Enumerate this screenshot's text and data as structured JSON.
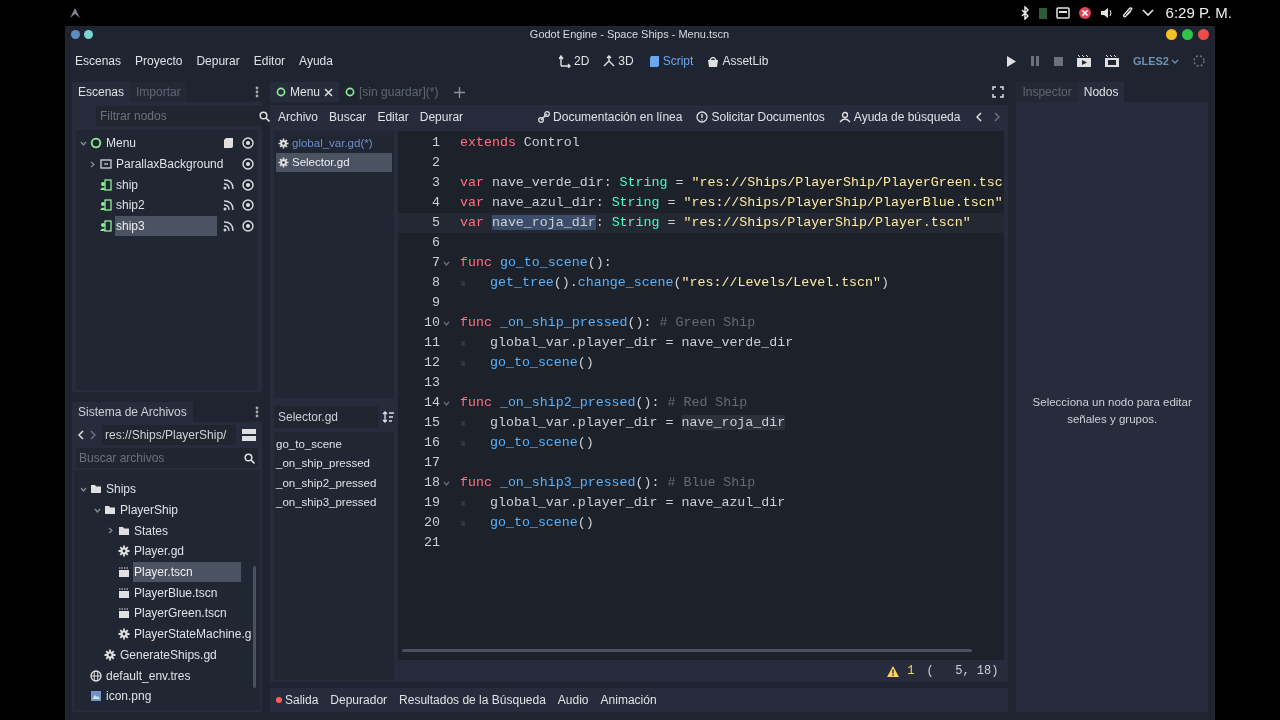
{
  "system_bar": {
    "time": "6:29 P. M."
  },
  "window": {
    "title": "Godot Engine - Space Ships - Menu.tscn"
  },
  "menu_bar": [
    "Escenas",
    "Proyecto",
    "Depurar",
    "Editor",
    "Ayuda"
  ],
  "workspaces": [
    {
      "kind": "flat",
      "label": "2D",
      "selected": false
    },
    {
      "kind": "spatial",
      "label": "3D",
      "selected": false
    },
    {
      "kind": "script",
      "label": "Script",
      "selected": true
    },
    {
      "kind": "assetlib",
      "label": "AssetLib",
      "selected": false
    }
  ],
  "renderer": "GLES2",
  "scene_dock": {
    "tabs": [
      {
        "label": "Escenas",
        "selected": true
      },
      {
        "label": "Importar",
        "selected": false
      }
    ],
    "filter": {
      "placeholder": "Filtrar nodos"
    },
    "tree": [
      {
        "label": "Menu",
        "kind": "control",
        "expanded": true,
        "selected": false,
        "children": [
          {
            "label": "ParallaxBackground",
            "kind": "parallax",
            "expanded": false,
            "selected": false
          },
          {
            "label": "ship",
            "kind": "instance",
            "selected": false
          },
          {
            "label": "ship2",
            "kind": "instance",
            "selected": false
          },
          {
            "label": "ship3",
            "kind": "instance",
            "selected": true
          }
        ]
      }
    ]
  },
  "filesystem": {
    "tab": "Sistema de Archivos",
    "path": "res://Ships/PlayerShip/",
    "search": {
      "placeholder": "Buscar archivos"
    },
    "tree": [
      {
        "label": "Ships",
        "kind": "folder",
        "expanded": true,
        "selected": false,
        "children": [
          {
            "label": "PlayerShip",
            "kind": "folder",
            "expanded": true,
            "selected": false,
            "children": [
              {
                "label": "States",
                "kind": "folder",
                "expanded": false,
                "selected": false
              },
              {
                "label": "Player.gd",
                "kind": "script",
                "selected": false
              },
              {
                "label": "Player.tscn",
                "kind": "scene",
                "selected": true
              },
              {
                "label": "PlayerBlue.tscn",
                "kind": "scene",
                "selected": false
              },
              {
                "label": "PlayerGreen.tscn",
                "kind": "scene",
                "selected": false
              },
              {
                "label": "PlayerStateMachine.g",
                "kind": "script",
                "selected": false
              }
            ]
          },
          {
            "label": "GenerateShips.gd",
            "kind": "script",
            "selected": false
          }
        ]
      },
      {
        "label": "default_env.tres",
        "kind": "environment",
        "selected": false
      },
      {
        "label": "icon.png",
        "kind": "image",
        "selected": false
      }
    ]
  },
  "scene_tabs": [
    {
      "label": "Menu",
      "selected": true
    },
    {
      "label": "[sin guardar](*)",
      "selected": false
    }
  ],
  "script_menu": [
    "Archivo",
    "Buscar",
    "Editar",
    "Depurar"
  ],
  "help_links": [
    {
      "kind": "docs",
      "label": "Documentación en línea"
    },
    {
      "kind": "request",
      "label": "Solicitar Documentos"
    },
    {
      "kind": "search",
      "label": "Ayuda de búsqueda"
    }
  ],
  "scripts": [
    {
      "label": "global_var.gd(*)",
      "modified": true,
      "selected": false
    },
    {
      "label": "Selector.gd",
      "modified": false,
      "selected": true
    }
  ],
  "methods": {
    "filter": "Selector.gd",
    "items": [
      "go_to_scene",
      "_on_ship_pressed",
      "_on_ship2_pressed",
      "_on_ship3_pressed"
    ]
  },
  "code": [
    {
      "number": "1",
      "current": false,
      "fold": false,
      "indent": false,
      "tokens": [
        {
          "kind": "kw",
          "text": "extends"
        },
        {
          "kind": "txt",
          "text": " Control"
        }
      ]
    },
    {
      "number": "2",
      "current": false,
      "fold": false,
      "indent": false
    },
    {
      "number": "3",
      "current": false,
      "fold": false,
      "indent": false,
      "tokens": [
        {
          "kind": "kw",
          "text": "var"
        },
        {
          "kind": "txt",
          "text": " nave_verde_dir: "
        },
        {
          "kind": "type",
          "text": "String"
        },
        {
          "kind": "txt",
          "text": " = "
        },
        {
          "kind": "str",
          "text": "\"res://Ships/PlayerShip/PlayerGreen.tsc"
        }
      ]
    },
    {
      "number": "4",
      "current": false,
      "fold": false,
      "indent": false,
      "tokens": [
        {
          "kind": "kw",
          "text": "var"
        },
        {
          "kind": "txt",
          "text": " nave_azul_dir: "
        },
        {
          "kind": "type",
          "text": "String"
        },
        {
          "kind": "txt",
          "text": " = "
        },
        {
          "kind": "str",
          "text": "\"res://Ships/PlayerShip/PlayerBlue.tscn\""
        }
      ]
    },
    {
      "number": "5",
      "current": true,
      "fold": false,
      "indent": false,
      "tokens": [
        {
          "kind": "kw",
          "text": "var "
        },
        {
          "kind": "selection",
          "text": "nave_roja_dir"
        },
        {
          "kind": "txt",
          "text": ": "
        },
        {
          "kind": "type",
          "text": "String"
        },
        {
          "kind": "txt",
          "text": " = "
        },
        {
          "kind": "str",
          "text": "\"res://Ships/PlayerShip/Player.tscn\""
        }
      ]
    },
    {
      "number": "6",
      "current": false,
      "fold": false,
      "indent": false
    },
    {
      "number": "7",
      "current": false,
      "fold": true,
      "indent": false,
      "tokens": [
        {
          "kind": "kw",
          "text": "func "
        },
        {
          "kind": "fn",
          "text": "go_to_scene"
        },
        {
          "kind": "txt",
          "text": "():"
        }
      ]
    },
    {
      "number": "8",
      "current": false,
      "fold": false,
      "indent": true,
      "tokens": [
        {
          "kind": "fn",
          "text": "get_tree"
        },
        {
          "kind": "txt",
          "text": "()."
        },
        {
          "kind": "fn",
          "text": "change_scene"
        },
        {
          "kind": "txt",
          "text": "("
        },
        {
          "kind": "str",
          "text": "\"res://Levels/Level.tscn\""
        },
        {
          "kind": "txt",
          "text": ")"
        }
      ]
    },
    {
      "number": "9",
      "current": false,
      "fold": false,
      "indent": false
    },
    {
      "number": "10",
      "current": false,
      "fold": true,
      "indent": false,
      "tokens": [
        {
          "kind": "kw",
          "text": "func "
        },
        {
          "kind": "fn",
          "text": "_on_ship_pressed"
        },
        {
          "kind": "txt",
          "text": "(): "
        },
        {
          "kind": "cmt",
          "text": "# Green Ship"
        }
      ]
    },
    {
      "number": "11",
      "current": false,
      "fold": false,
      "indent": true,
      "tokens": [
        {
          "kind": "txt",
          "text": "global_var.player_dir = nave_verde_dir"
        }
      ]
    },
    {
      "number": "12",
      "current": false,
      "fold": false,
      "indent": true,
      "tokens": [
        {
          "kind": "fn",
          "text": "go_to_scene"
        },
        {
          "kind": "txt",
          "text": "()"
        }
      ]
    },
    {
      "number": "13",
      "current": false,
      "fold": false,
      "indent": false
    },
    {
      "number": "14",
      "current": false,
      "fold": true,
      "indent": false,
      "tokens": [
        {
          "kind": "kw",
          "text": "func "
        },
        {
          "kind": "fn",
          "text": "_on_ship2_pressed"
        },
        {
          "kind": "txt",
          "text": "(): "
        },
        {
          "kind": "cmt",
          "text": "# Red Ship"
        }
      ]
    },
    {
      "number": "15",
      "current": false,
      "fold": false,
      "indent": true,
      "tokens": [
        {
          "kind": "txt",
          "text": "global_var.player_dir = "
        },
        {
          "kind": "occurrence",
          "text": "nave_roja_dir"
        }
      ]
    },
    {
      "number": "16",
      "current": false,
      "fold": false,
      "indent": true,
      "tokens": [
        {
          "kind": "fn",
          "text": "go_to_scene"
        },
        {
          "kind": "txt",
          "text": "()"
        }
      ]
    },
    {
      "number": "17",
      "current": false,
      "fold": false,
      "indent": false
    },
    {
      "number": "18",
      "current": false,
      "fold": true,
      "indent": false,
      "tokens": [
        {
          "kind": "kw",
          "text": "func "
        },
        {
          "kind": "fn",
          "text": "_on_ship3_pressed"
        },
        {
          "kind": "txt",
          "text": "(): "
        },
        {
          "kind": "cmt",
          "text": "# Blue Ship"
        }
      ]
    },
    {
      "number": "19",
      "current": false,
      "fold": false,
      "indent": true,
      "tokens": [
        {
          "kind": "txt",
          "text": "global_var.player_dir = nave_azul_dir"
        }
      ]
    },
    {
      "number": "20",
      "current": false,
      "fold": false,
      "indent": true,
      "tokens": [
        {
          "kind": "fn",
          "text": "go_to_scene"
        },
        {
          "kind": "txt",
          "text": "()"
        }
      ]
    },
    {
      "number": "21",
      "current": false,
      "fold": false,
      "indent": false
    }
  ],
  "status": {
    "warnings": "1",
    "position": "(   5, 18)"
  },
  "bottom_tabs": [
    {
      "label": "Salida",
      "alert": true
    },
    {
      "label": "Depurador",
      "alert": false
    },
    {
      "label": "Resultados de la Búsqueda",
      "alert": false
    },
    {
      "label": "Audio",
      "alert": false
    },
    {
      "label": "Animación",
      "alert": false
    }
  ],
  "right_dock": {
    "tabs": [
      {
        "label": "Inspector",
        "selected": false
      },
      {
        "label": "Nodos",
        "selected": true
      }
    ],
    "message": "Selecciona un nodo para editar señales y grupos."
  }
}
